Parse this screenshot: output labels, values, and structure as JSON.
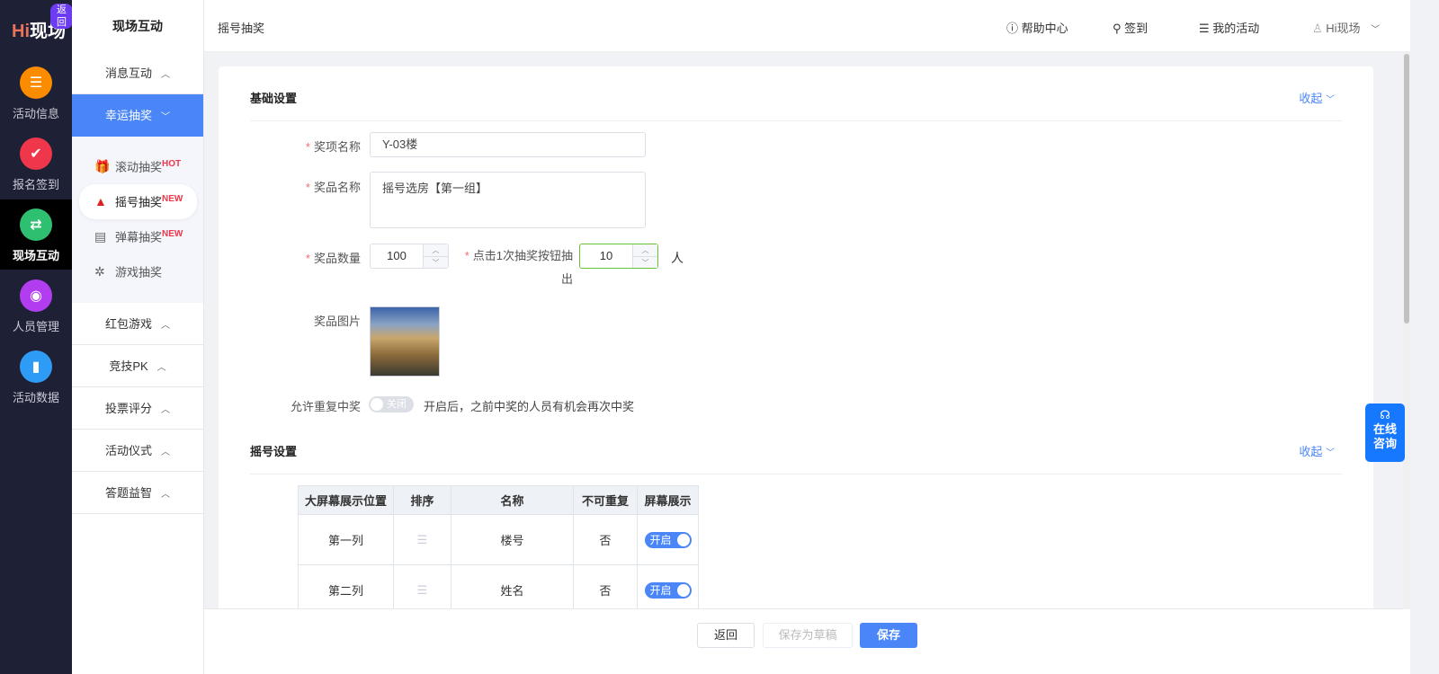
{
  "rail": {
    "logo": "Hi现场",
    "back": "返回",
    "items": [
      {
        "label": "活动信息",
        "icon": "document-icon",
        "color": "#fb8c00"
      },
      {
        "label": "报名签到",
        "icon": "calendar-check-icon",
        "color": "#f0364b"
      },
      {
        "label": "现场互动",
        "icon": "interaction-icon",
        "color": "#2fbf71",
        "active": true
      },
      {
        "label": "人员管理",
        "icon": "person-card-icon",
        "color": "#b23cf0"
      },
      {
        "label": "活动数据",
        "icon": "bar-chart-icon",
        "color": "#2e9cf7"
      }
    ]
  },
  "sidebar": {
    "title": "现场互动",
    "groups_before": [
      {
        "label": "消息互动"
      }
    ],
    "open_group": "幸运抽奖",
    "sub_items": [
      {
        "label": "滚动抽奖",
        "badge": "HOT",
        "icon": "gift-icon"
      },
      {
        "label": "摇号抽奖",
        "badge": "NEW",
        "icon": "person-icon",
        "active": true
      },
      {
        "label": "弹幕抽奖",
        "badge": "NEW",
        "icon": "barrage-icon"
      },
      {
        "label": "游戏抽奖",
        "badge": "",
        "icon": "wheel-icon"
      }
    ],
    "groups_after": [
      {
        "label": "红包游戏"
      },
      {
        "label": "竞技PK"
      },
      {
        "label": "投票评分"
      },
      {
        "label": "活动仪式"
      },
      {
        "label": "答题益智"
      }
    ]
  },
  "header": {
    "breadcrumb": "摇号抽奖",
    "help": "帮助中心",
    "checkin": "签到",
    "my_activities": "我的活动",
    "user": "Hi现场"
  },
  "basic": {
    "title": "基础设置",
    "collapse": "收起",
    "prize_item_label": "奖项名称",
    "prize_item_value": "Y-03楼",
    "prize_name_label": "奖品名称",
    "prize_name_value": "摇号选房【第一组】",
    "quantity_label": "奖品数量",
    "quantity_value": "100",
    "per_click_label": "点击1次抽奖按钮抽出",
    "per_click_value": "10",
    "per_click_unit": "人",
    "image_label": "奖品图片",
    "repeat_label": "允许重复中奖",
    "repeat_toggle": "关闭",
    "repeat_hint": "开启后，之前中奖的人员有机会再次中奖"
  },
  "lottery": {
    "title": "摇号设置",
    "collapse": "收起",
    "columns": [
      "大屏幕展示位置",
      "排序",
      "名称",
      "不可重复",
      "屏幕展示"
    ],
    "rows": [
      {
        "position": "第一列",
        "name": "楼号",
        "unique": "否",
        "display": "开启"
      },
      {
        "position": "第二列",
        "name": "姓名",
        "unique": "否",
        "display": "开启"
      }
    ]
  },
  "footer": {
    "back": "返回",
    "draft": "保存为草稿",
    "save": "保存"
  },
  "consult": {
    "line1": "在线",
    "line2": "咨询"
  },
  "colors": {
    "primary": "#4a86f7",
    "rail": "#1e2035",
    "focus_border": "#67c23a"
  }
}
